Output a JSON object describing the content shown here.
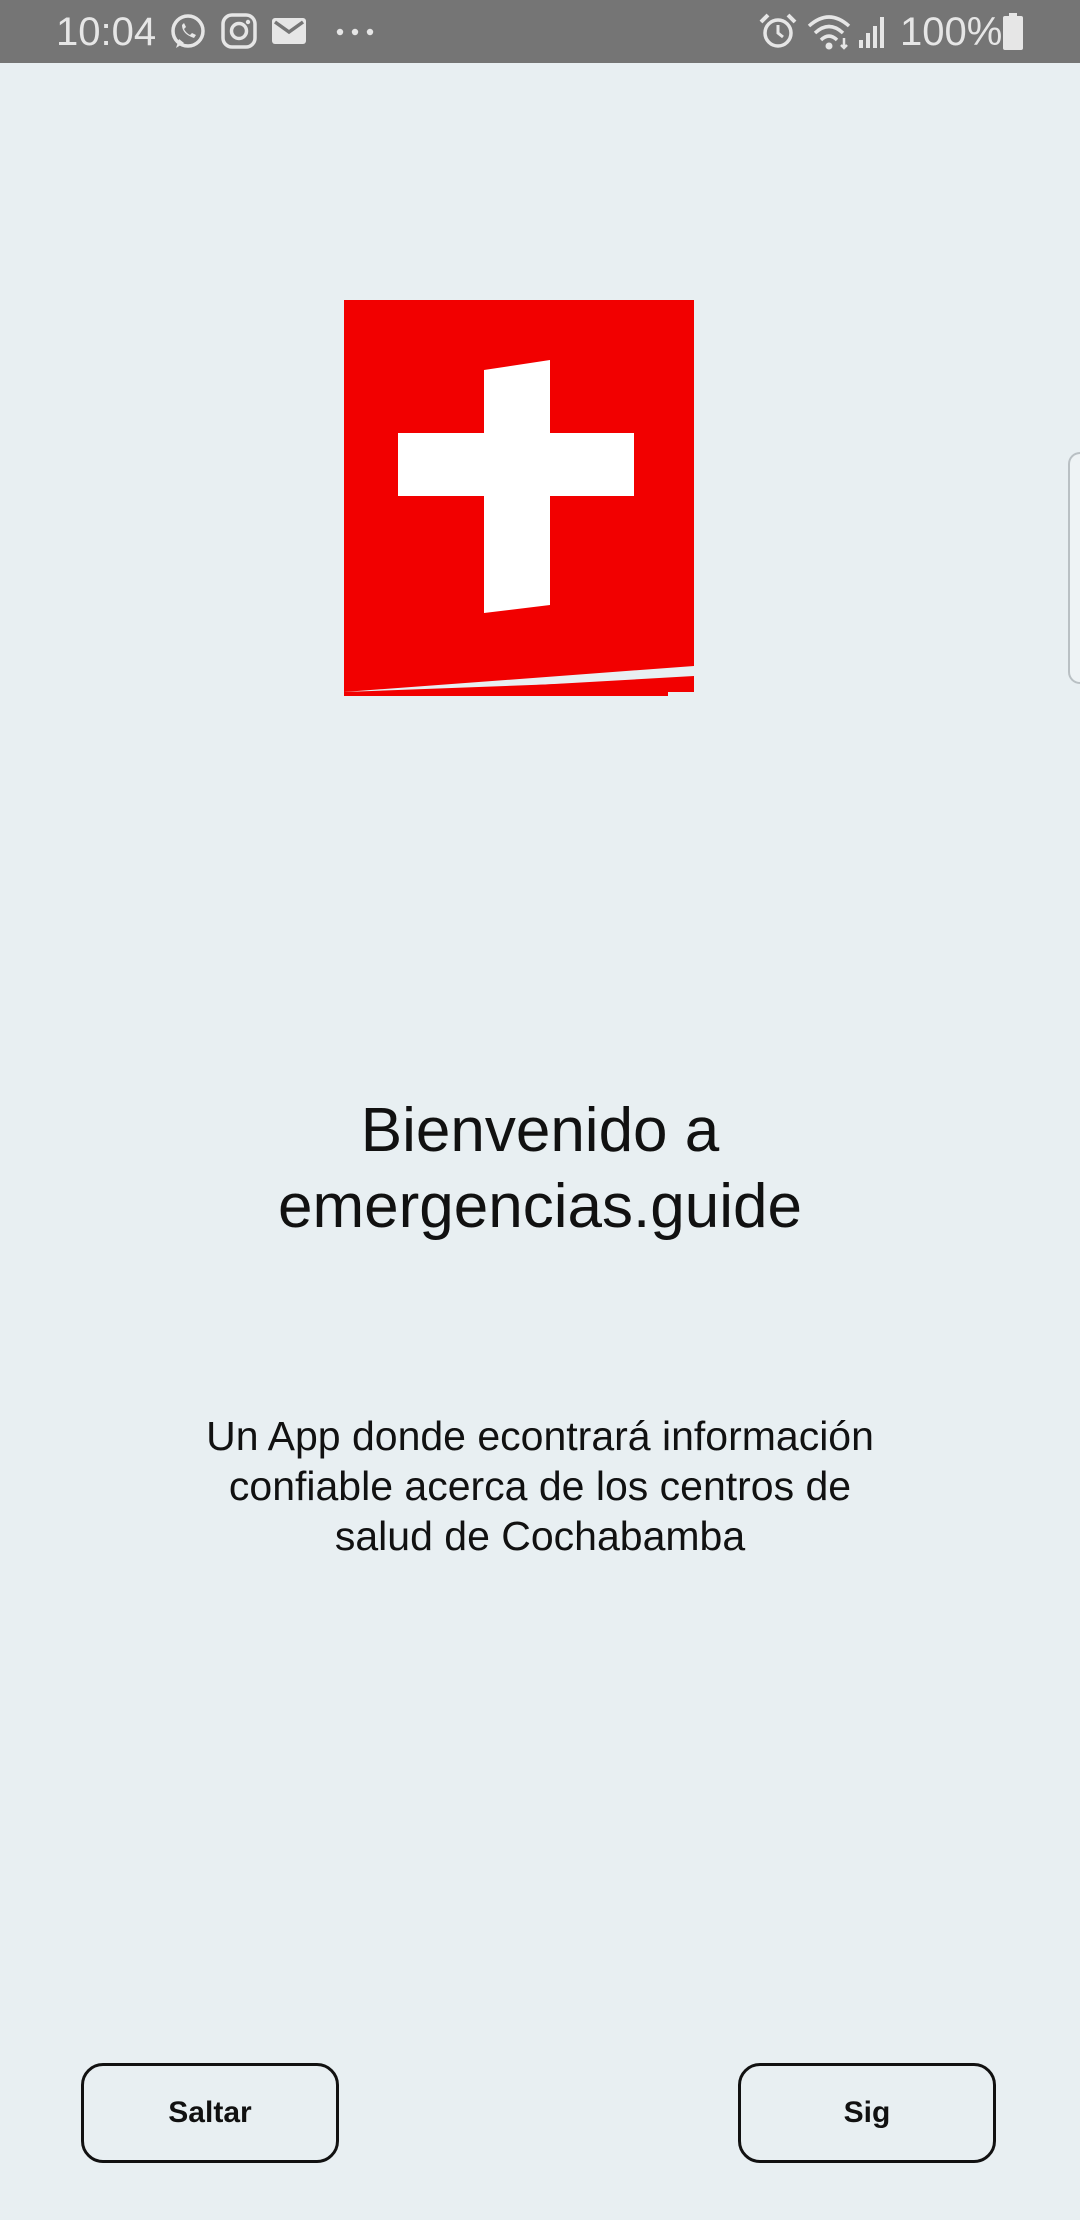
{
  "status_bar": {
    "time": "10:04",
    "notification_icons": [
      "whatsapp-icon",
      "instagram-icon",
      "gmail-icon",
      "more-dots-icon"
    ],
    "system_icons": [
      "alarm-icon",
      "wifi-icon",
      "signal-icon",
      "battery-icon"
    ],
    "battery_percent": "100%"
  },
  "logo": {
    "icon": "first-aid-cross-logo",
    "color": "#f20000"
  },
  "welcome": {
    "title_line1": "Bienvenido a",
    "title_line2": "emergencias.guide",
    "description": "Un App donde econtrará información confiable acerca de los centros de salud de Cochabamba"
  },
  "buttons": {
    "skip_label": "Saltar",
    "next_label": "Sig"
  },
  "colors": {
    "background": "#e8eff2",
    "status_bar": "#757575",
    "brand_red": "#f20000"
  }
}
